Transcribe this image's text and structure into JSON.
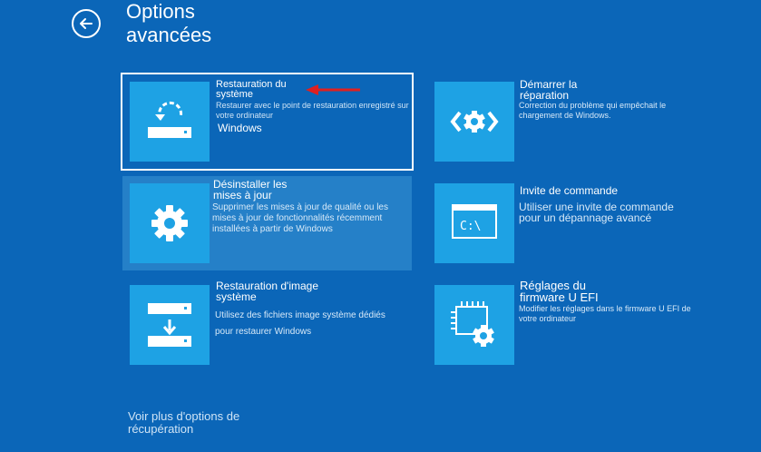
{
  "header": {
    "title": "Options avancées"
  },
  "options": {
    "restore": {
      "title": "Restauration du système",
      "desc": "Restaurer avec le point de restauration enregistré sur votre ordinateur",
      "sub": "Windows"
    },
    "uninstall": {
      "title": "Désinstaller les mises à jour",
      "desc": "Supprimer les mises à jour de qualité ou les mises à jour de fonctionnalités récemment installées à partir de Windows"
    },
    "image": {
      "title": "Restauration d'image système",
      "desc": "Utilisez des fichiers image système dédiés pour restaurer Windows"
    },
    "startup": {
      "title": "Démarrer la réparation",
      "desc": "Correction du problème qui empêchait le chargement de Windows."
    },
    "cmd": {
      "title": "Invite de commande",
      "desc": "Utiliser une invite de commande pour un dépannage avancé",
      "icon_text": "C:\\"
    },
    "uefi": {
      "title": "Réglages du firmware U EFI",
      "desc": "Modifier les réglages dans le firmware U EFI de votre ordinateur"
    }
  },
  "footer": {
    "more_link": "Voir plus d'options de récupération"
  },
  "colors": {
    "background": "#0b66b8",
    "tile": "#1ea2e4",
    "highlight_row": "#2580c8",
    "arrow": "#e02020"
  }
}
